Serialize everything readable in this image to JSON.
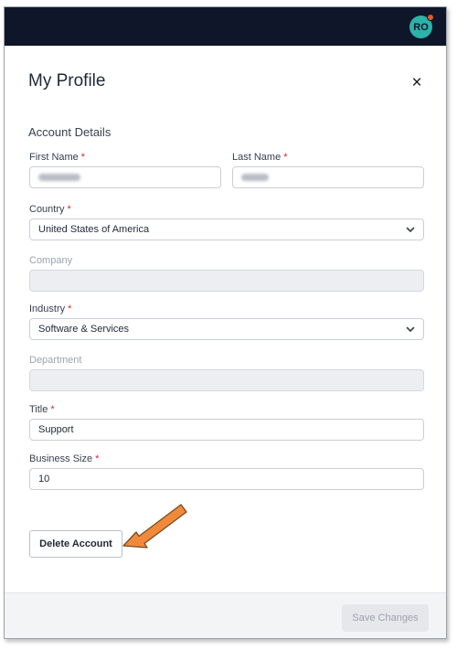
{
  "header": {
    "avatar_initials": "RO"
  },
  "modal": {
    "title": "My Profile",
    "close_label": "×",
    "section_title": "Account Details",
    "fields": {
      "first_name": {
        "label": "First Name",
        "required_mark": "*"
      },
      "last_name": {
        "label": "Last Name",
        "required_mark": "*"
      },
      "country": {
        "label": "Country",
        "required_mark": "*",
        "value": "United States of America"
      },
      "company": {
        "label": "Company",
        "value": ""
      },
      "industry": {
        "label": "Industry",
        "required_mark": "*",
        "value": "Software & Services"
      },
      "department": {
        "label": "Department",
        "value": ""
      },
      "title": {
        "label": "Title",
        "required_mark": "*",
        "value": "Support"
      },
      "business_size": {
        "label": "Business Size",
        "required_mark": "*",
        "value": "10"
      }
    },
    "delete_button_label": "Delete Account",
    "save_button_label": "Save Changes"
  },
  "colors": {
    "topbar": "#0f1629",
    "avatar": "#2bb3a8",
    "notification_dot": "#e4572e",
    "required": "#dc2626",
    "arrow": "#f08a3a"
  }
}
